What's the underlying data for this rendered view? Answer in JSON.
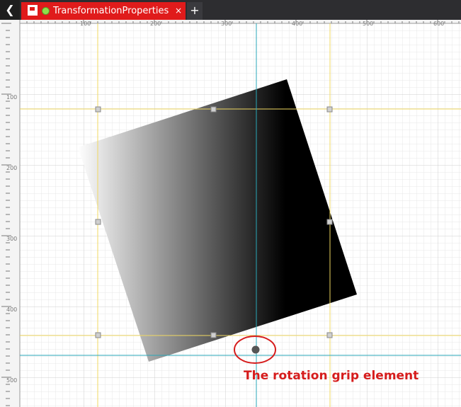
{
  "tab": {
    "back_icon": "chevron-left-icon",
    "doc_icon": "document-icon",
    "status_color": "#8ee04a",
    "title": "TransformationProperties",
    "close_label": "×",
    "add_label": "+"
  },
  "ruler": {
    "h_labels": [
      "100",
      "200",
      "300",
      "400",
      "500",
      "600"
    ],
    "v_labels": [
      "100",
      "200",
      "300",
      "400",
      "500"
    ]
  },
  "annotation": {
    "text": "The rotation grip element",
    "color": "#d61c1c"
  },
  "colors": {
    "tab_active": "#e01b1b",
    "guide_yellow": "#f0d860",
    "guide_cyan": "#2aa7b8"
  }
}
